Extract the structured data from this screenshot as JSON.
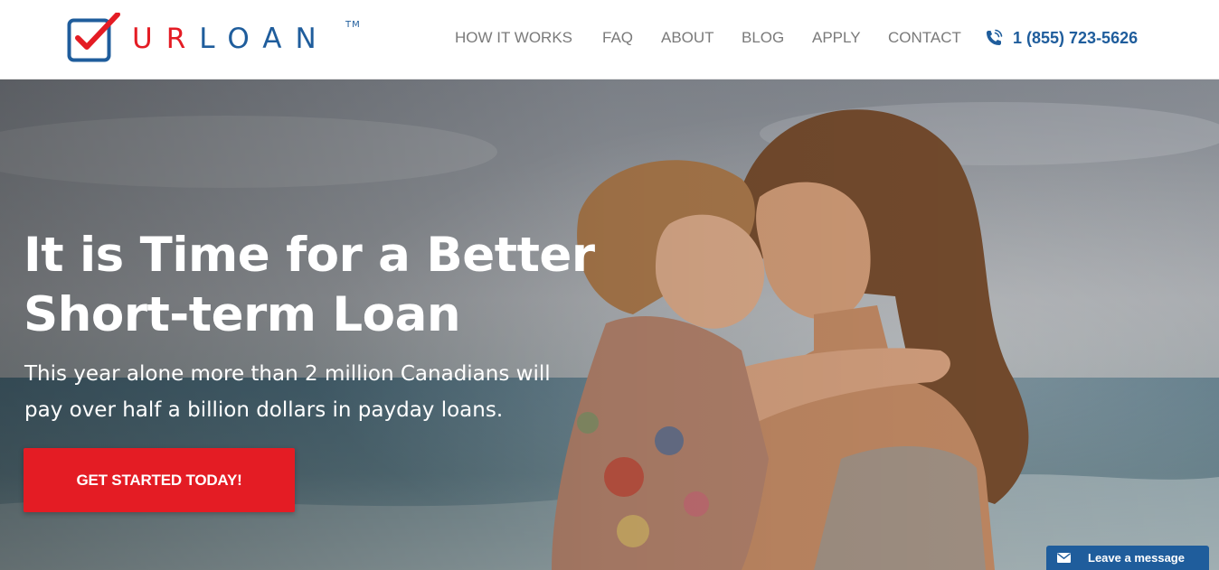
{
  "brand": {
    "name_part1": "UR",
    "name_part2": "LOAN",
    "trademark": "TM",
    "logo_icon": "checkbox-check-icon"
  },
  "nav": {
    "items": [
      {
        "label": "HOW IT WORKS"
      },
      {
        "label": "FAQ"
      },
      {
        "label": "ABOUT"
      },
      {
        "label": "BLOG"
      },
      {
        "label": "APPLY"
      },
      {
        "label": "CONTACT"
      }
    ],
    "phone": {
      "icon": "phone-icon",
      "number": "1 (855) 723-5626"
    }
  },
  "hero": {
    "title_line1": "It is Time for a Better",
    "title_line2": "Short-term Loan",
    "subtitle_line1": "This year alone more than 2 million Canadians will",
    "subtitle_line2": "pay over half a billion dollars in payday loans.",
    "cta_label": "GET STARTED TODAY!",
    "background": "mother-and-daughter-beach-photo"
  },
  "chat_widget": {
    "icon": "envelope-icon",
    "label": "Leave a message"
  },
  "colors": {
    "brand_red": "#e41c24",
    "brand_blue": "#1f5d9c",
    "nav_text": "#7a7a7a",
    "hero_text": "#ffffff"
  }
}
